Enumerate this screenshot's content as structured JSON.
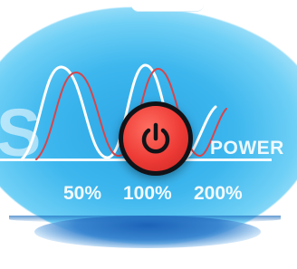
{
  "panel": {
    "power_label": "POWER",
    "letter_fragment": "S",
    "power_levels": [
      "50%",
      "100%",
      "200%"
    ]
  },
  "power_button": {
    "icon": "power-icon",
    "color": "#ee3b36"
  },
  "colors": {
    "panel_blue": "#3db7ee",
    "wave_white": "#ffffff",
    "wave_red": "#d9444a"
  }
}
